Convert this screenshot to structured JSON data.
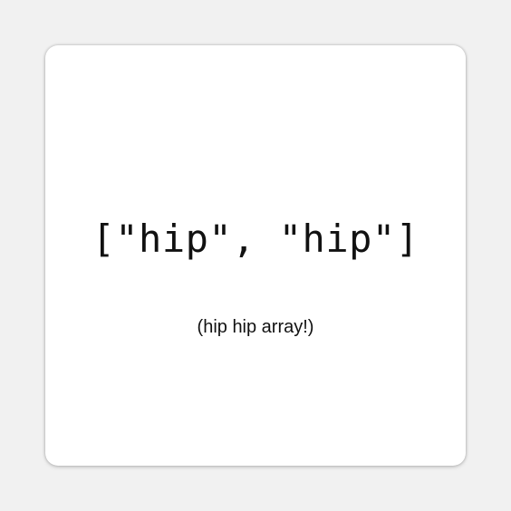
{
  "sticker": {
    "code_text": "[\"hip\", \"hip\"]",
    "caption": "(hip hip array!)"
  },
  "colors": {
    "background": "#f1f1f1",
    "sticker": "#ffffff",
    "text": "#111111"
  }
}
